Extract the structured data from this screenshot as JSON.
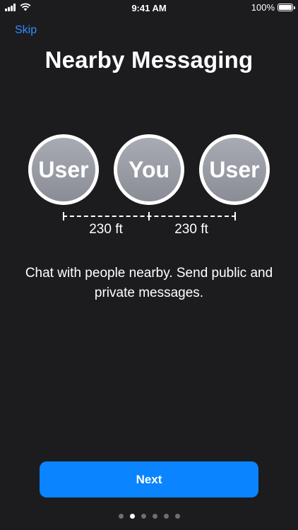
{
  "status_bar": {
    "time": "9:41 AM",
    "battery_percent": "100%",
    "battery_level": 1.0
  },
  "skip_label": "Skip",
  "title": "Nearby Messaging",
  "avatars": [
    {
      "label": "User"
    },
    {
      "label": "You"
    },
    {
      "label": "User"
    }
  ],
  "distances": [
    "230 ft",
    "230 ft"
  ],
  "description": "Chat with people nearby. Send public and private messages.",
  "next_label": "Next",
  "pagination": {
    "total": 6,
    "current": 2
  },
  "colors": {
    "background": "#1c1c1e",
    "accent": "#0a84ff",
    "link": "#2f8cff",
    "avatar": "#9a9ca5"
  }
}
